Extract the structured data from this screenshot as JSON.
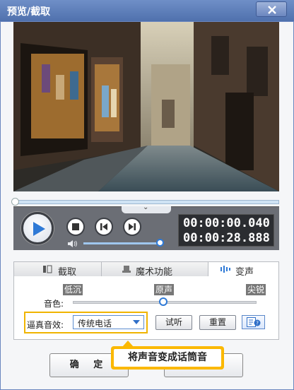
{
  "window": {
    "title": "预览/截取",
    "close_icon": "close-icon"
  },
  "player": {
    "current_time": "00:00:00.040",
    "total_time": "00:00:28.888",
    "volume_level": 0.95,
    "progress_level": 0.0,
    "icons": [
      "play-icon",
      "stop-icon",
      "previous-frame-icon",
      "next-frame-icon",
      "volume-icon",
      "chevron-down-icon"
    ]
  },
  "tabs": [
    {
      "label": "截取",
      "icon": "crop-icon",
      "active": false
    },
    {
      "label": "魔术功能",
      "icon": "magic-hat-icon",
      "active": false
    },
    {
      "label": "变声",
      "icon": "sound-wave-icon",
      "active": true
    }
  ],
  "voice": {
    "presets": {
      "low": "低沉",
      "original": "原声",
      "sharp": "尖锐"
    },
    "tone_label": "音色:",
    "tone_level": 0.5,
    "effect_label": "逼真音效:",
    "effect_value": "传统电话",
    "listen_button": "试听",
    "reset_button": "重置",
    "help_icon": "help-icon"
  },
  "footer": {
    "confirm_button": "确 定",
    "tooltip": "将声音变成话筒音"
  },
  "colors": {
    "titlebar": "#5d7fbd",
    "accent_blue": "#2f7ad6",
    "highlight_yellow": "#fbb800"
  }
}
